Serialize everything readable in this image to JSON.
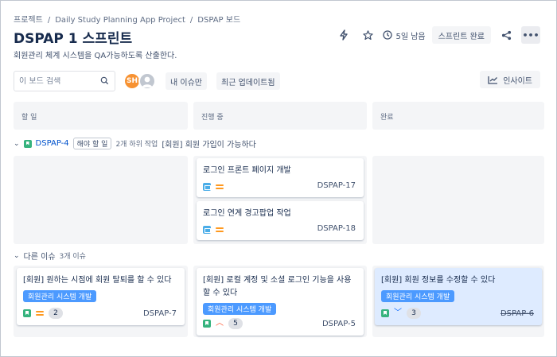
{
  "breadcrumb": [
    "프로젝트",
    "Daily Study Planning App Project",
    "DSPAP 보드"
  ],
  "header": {
    "title": "DSPAP 1 스프린트",
    "subtitle": "회원관리 체계 시스템을 QA가능하도록 산출한다.",
    "days_remaining": "5일 남음",
    "complete_label": "스프린트 완료",
    "more_label": "•••"
  },
  "toolbar": {
    "search_placeholder": "이 보드 검색",
    "avatar_initials": "SH",
    "my_issues": "내 이슈만",
    "recent_updates": "최근 업데이트됨",
    "insight": "인사이트"
  },
  "columns": [
    "할 일",
    "진행 중",
    "완료"
  ],
  "swimlane_story": {
    "key": "DSPAP-4",
    "status": "해야 할 일",
    "count": "2개 하위 작업",
    "summary": "[회원] 회원 가입이 가능하다"
  },
  "swimlane_other": {
    "label": "다른 이슈",
    "count": "3개 이슈"
  },
  "subtask_cards": [
    {
      "title": "로그인 프론트 페이지 개발",
      "key": "DSPAP-17"
    },
    {
      "title": "로그인 연계 경고팝업 작업",
      "key": "DSPAP-18"
    }
  ],
  "other_cards": [
    {
      "title": "[회원] 원하는 시점에 회원 탈퇴를 할 수 있다",
      "epic": "회원관리 시스템 개발",
      "points": "2",
      "key": "DSPAP-7",
      "priority": "medium"
    },
    {
      "title": "[회원] 로컬 계정 및 소셜 로그인 기능을 사용할 수 있다",
      "epic": "회원관리 시스템 개발",
      "points": "5",
      "key": "DSPAP-5",
      "priority": "high"
    },
    {
      "title": "[회원] 회원 정보를 수정할 수 있다",
      "epic": "회원관리 시스템 개발",
      "points": "3",
      "key": "DSPAP-6",
      "priority": "low"
    }
  ],
  "colors": {
    "accent": "#0052cc",
    "epic": "#4c9aff",
    "story": "#36b37e",
    "task": "#4bade8",
    "selected_card": "#deebff",
    "priority_medium": "#ff991f",
    "priority_high": "#ff5630",
    "priority_low": "#0065ff"
  }
}
